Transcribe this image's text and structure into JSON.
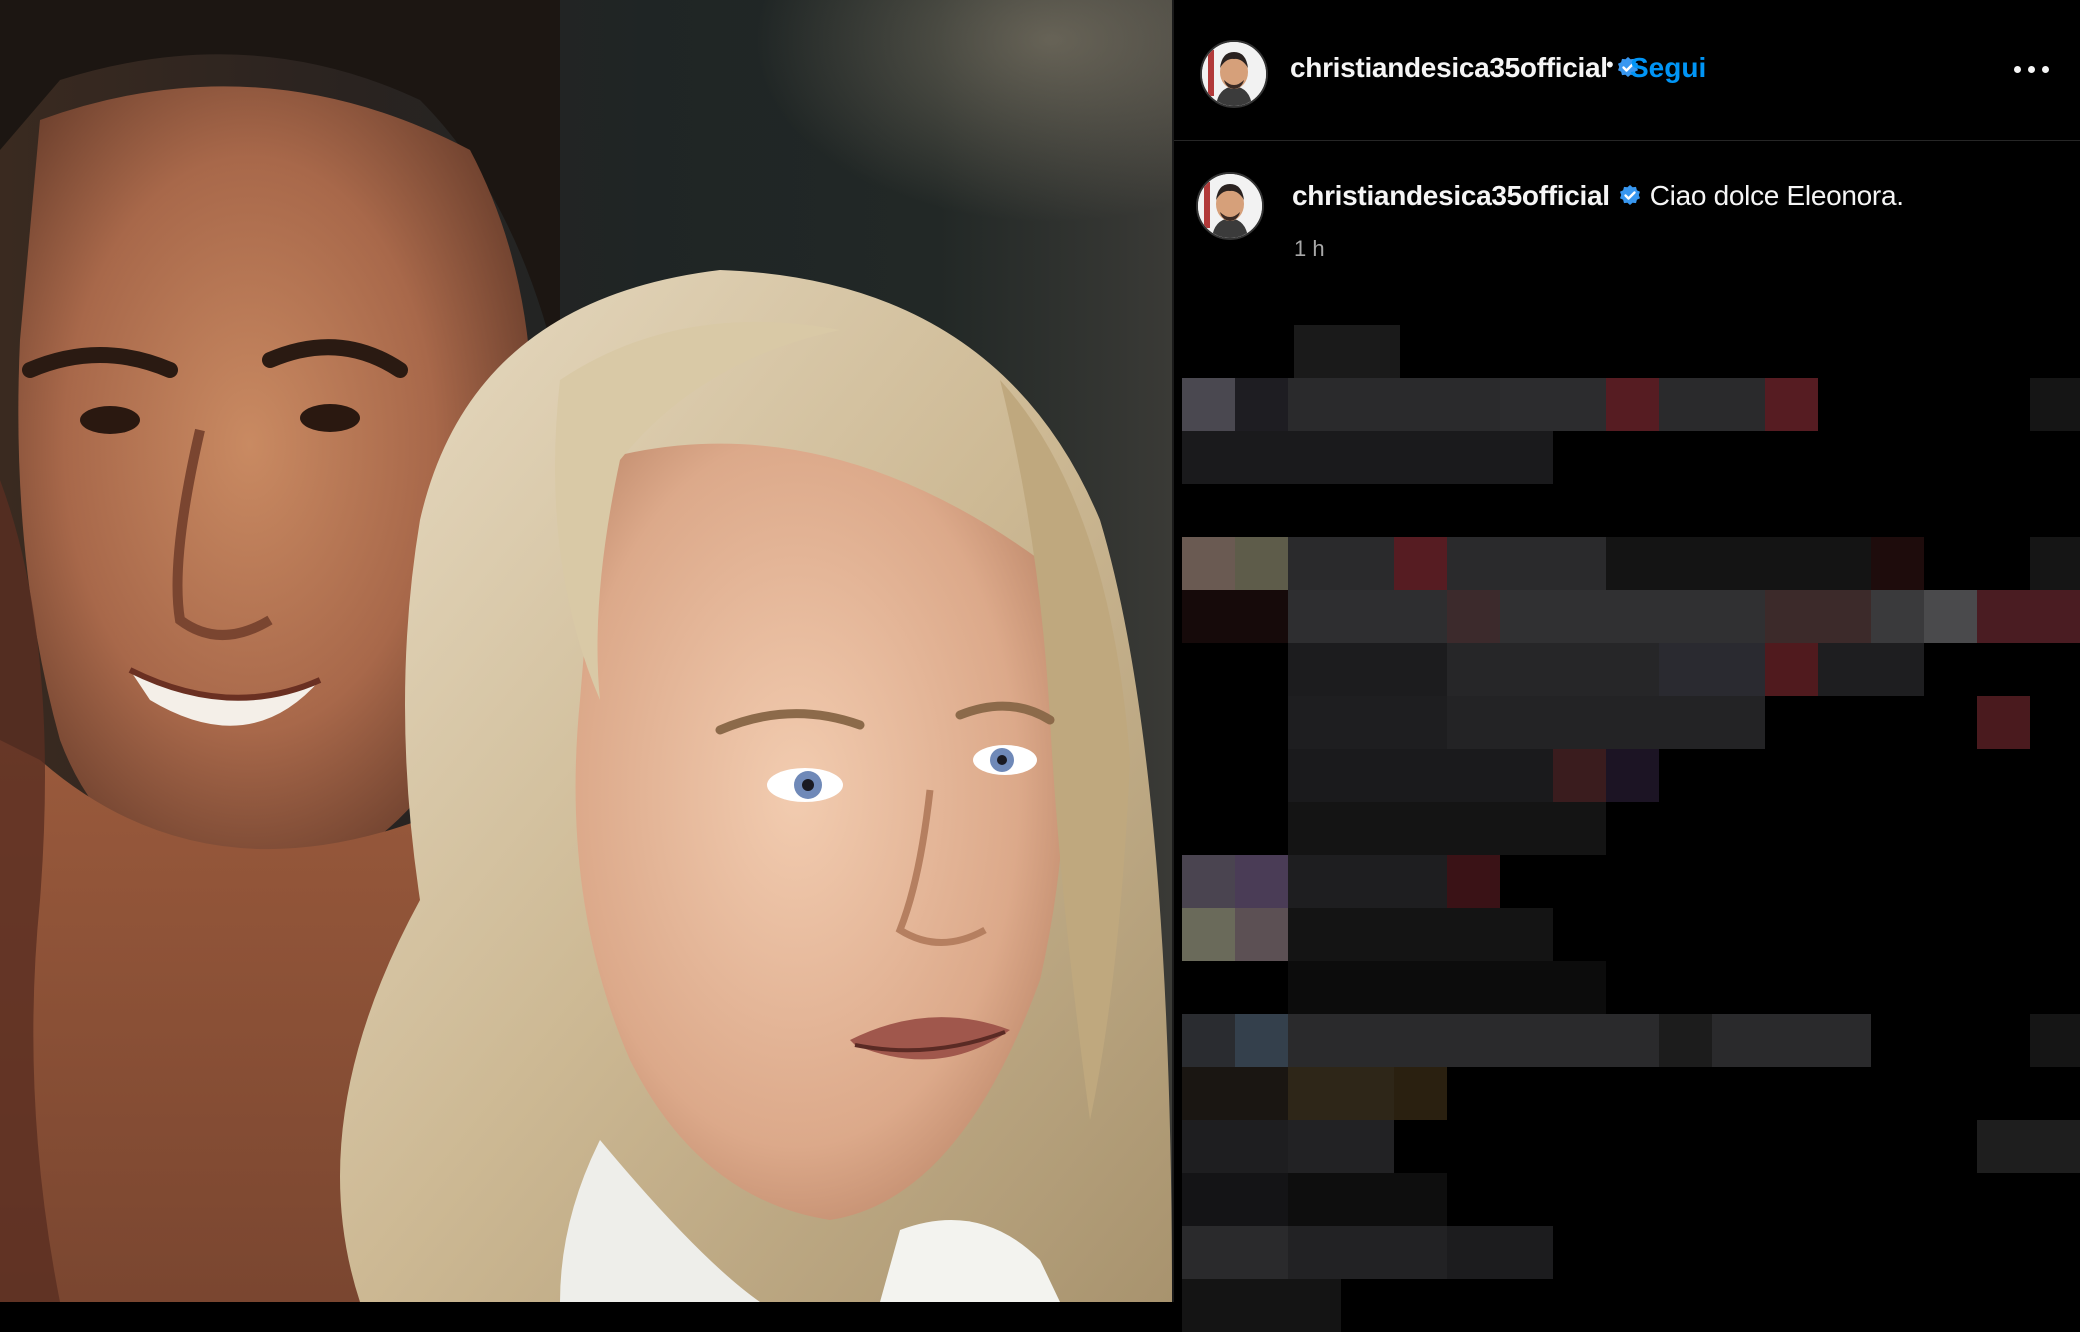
{
  "post": {
    "username": "christiandesica35official",
    "follow_label": "Segui",
    "separator": "•",
    "caption_text": "Ciao dolce Eleonora.",
    "timestamp": "1 h",
    "verified": true
  },
  "icons": {
    "verified": "verified-badge-icon",
    "more": "more-options-icon"
  },
  "colors": {
    "background": "#000000",
    "link_blue": "#0095f6",
    "verified_blue": "#3897f0",
    "muted_text": "#a8a8a8"
  }
}
